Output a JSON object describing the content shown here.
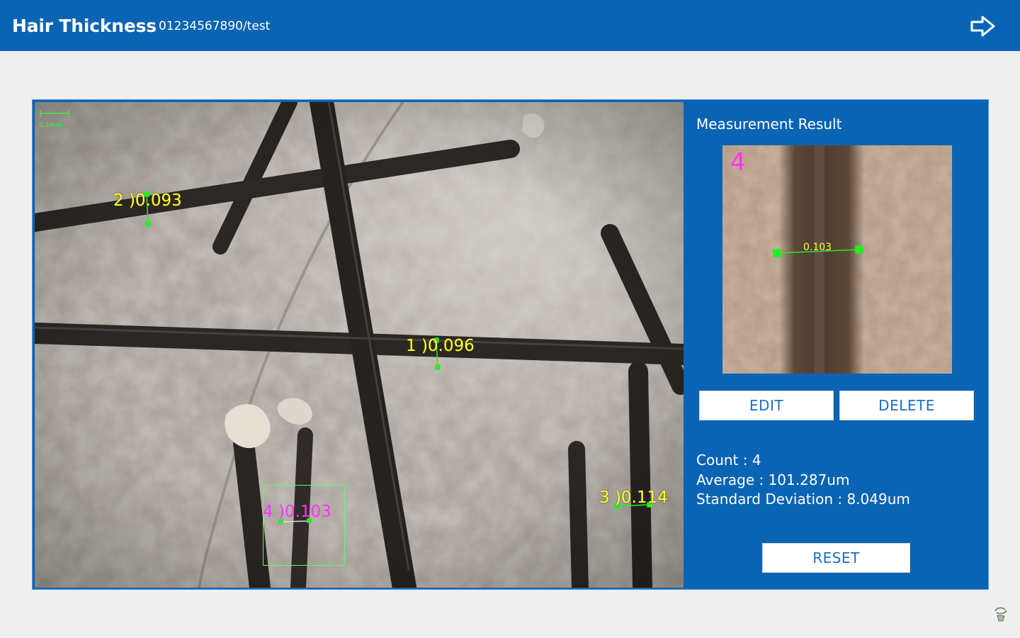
{
  "header": {
    "title": "Hair Thickness",
    "subtitle": "01234567890/test",
    "exit_icon": "exit-arrow-icon"
  },
  "viewer": {
    "scale_label": "0.1mm",
    "measurements": [
      {
        "label": "1 )0.096"
      },
      {
        "label": "2 )0.093"
      },
      {
        "label": "3 )0.114"
      },
      {
        "label": "4 )0.103"
      }
    ]
  },
  "result": {
    "title": "Measurement Result",
    "selected_number": "4",
    "selected_value": "0.103",
    "edit_label": "EDIT",
    "delete_label": "DELETE",
    "count": "Count : 4",
    "average": "Average : 101.287um",
    "std_dev": "Standard Deviation : 8.049um",
    "reset_label": "RESET"
  },
  "colors": {
    "brand": "#0a64b4",
    "label_yellow": "#ffff2e",
    "label_magenta": "#ff33ff",
    "marker_green": "#22ee22"
  },
  "footer": {
    "corner_icon": "sync-hand-icon"
  }
}
